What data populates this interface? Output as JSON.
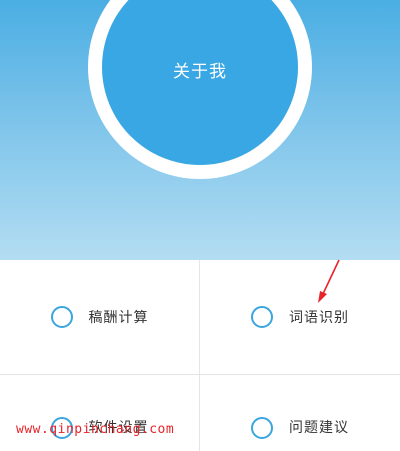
{
  "profile": {
    "about_label": "关于我"
  },
  "menu": {
    "items": [
      {
        "label": "稿酬计算",
        "icon": "circle-icon"
      },
      {
        "label": "词语识别",
        "icon": "circle-icon"
      },
      {
        "label": "软件设置",
        "icon": "circle-icon"
      },
      {
        "label": "问题建议",
        "icon": "circle-icon"
      }
    ]
  },
  "watermark": "www.qinpinchang.com",
  "colors": {
    "accent": "#39a7e3",
    "annotation": "#e8242b"
  }
}
